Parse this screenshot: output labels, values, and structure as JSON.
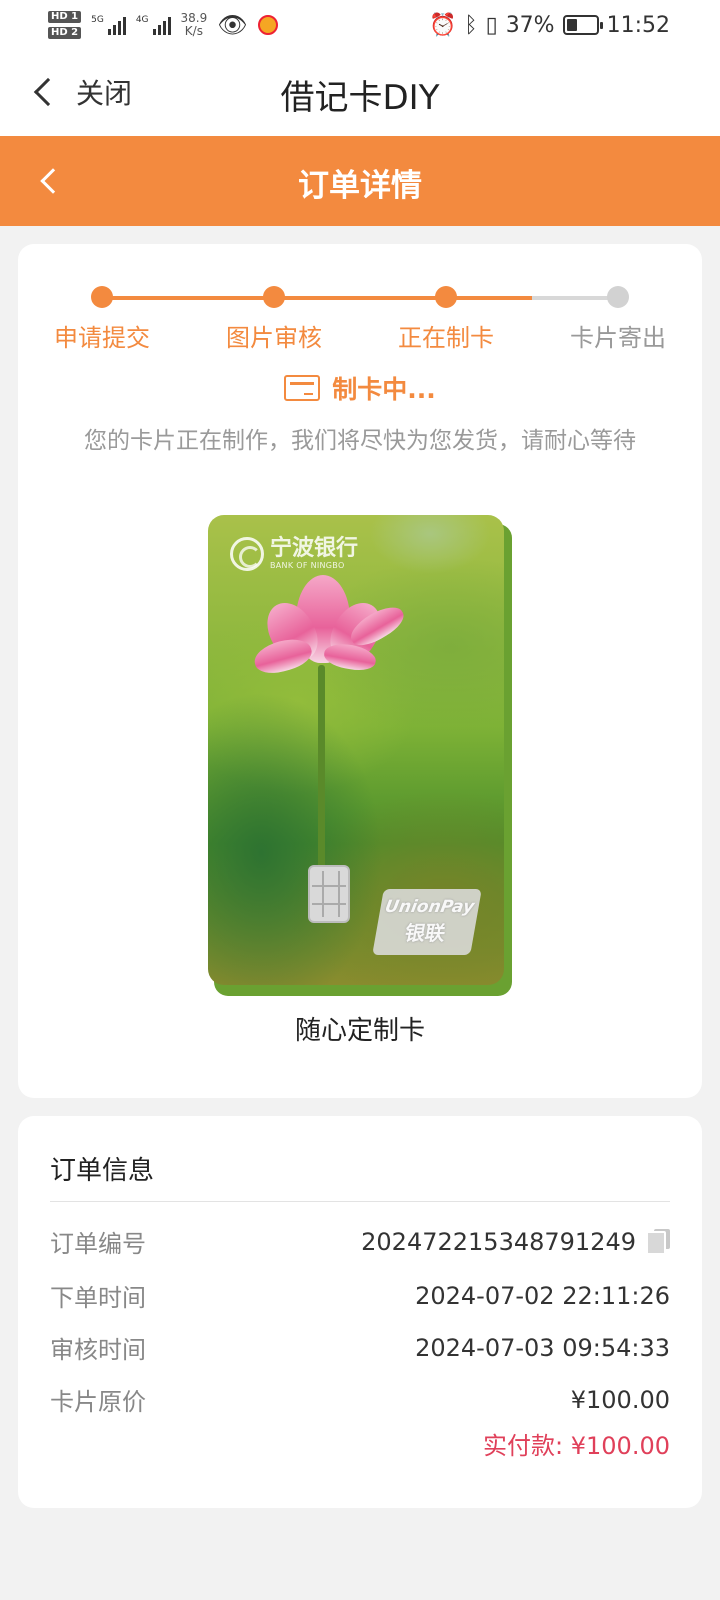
{
  "status_bar": {
    "hd1": "HD 1",
    "hd2": "HD 2",
    "net1": "5G",
    "net2": "4G",
    "speed_value": "38.9",
    "speed_unit": "K/s",
    "battery_percent": "37%",
    "battery_level": 0.37,
    "time": "11:52",
    "icons": [
      "eye-icon",
      "weibo-icon",
      "alarm-icon",
      "bluetooth-icon",
      "vibrate-icon",
      "battery-icon"
    ]
  },
  "navbar": {
    "close_label": "关闭",
    "title": "借记卡DIY"
  },
  "header": {
    "title": "订单详情"
  },
  "progress": {
    "steps": [
      {
        "label": "申请提交",
        "active": true
      },
      {
        "label": "图片审核",
        "active": true
      },
      {
        "label": "正在制卡",
        "active": true
      },
      {
        "label": "卡片寄出",
        "active": false
      }
    ],
    "status_text": "制卡中...",
    "description": "您的卡片正在制作，我们将尽快为您发货，请耐心等待"
  },
  "bank_card": {
    "bank_name_cn": "宁波银行",
    "bank_name_en": "BANK OF NINGBO",
    "network_en": "UnionPay",
    "network_cn": "银联",
    "card_name": "随心定制卡"
  },
  "order_info": {
    "title": "订单信息",
    "rows": [
      {
        "label": "订单编号",
        "value": "202472215348791249"
      },
      {
        "label": "下单时间",
        "value": "2024-07-02 22:11:26"
      },
      {
        "label": "审核时间",
        "value": "2024-07-03 09:54:33"
      },
      {
        "label": "卡片原价",
        "value": "¥100.00"
      }
    ],
    "paid": "实付款: ¥100.00"
  },
  "colors": {
    "accent": "#f38a3f",
    "inactive": "#d2d2d2",
    "paid": "#e0405a",
    "background": "#f2f2f2"
  }
}
